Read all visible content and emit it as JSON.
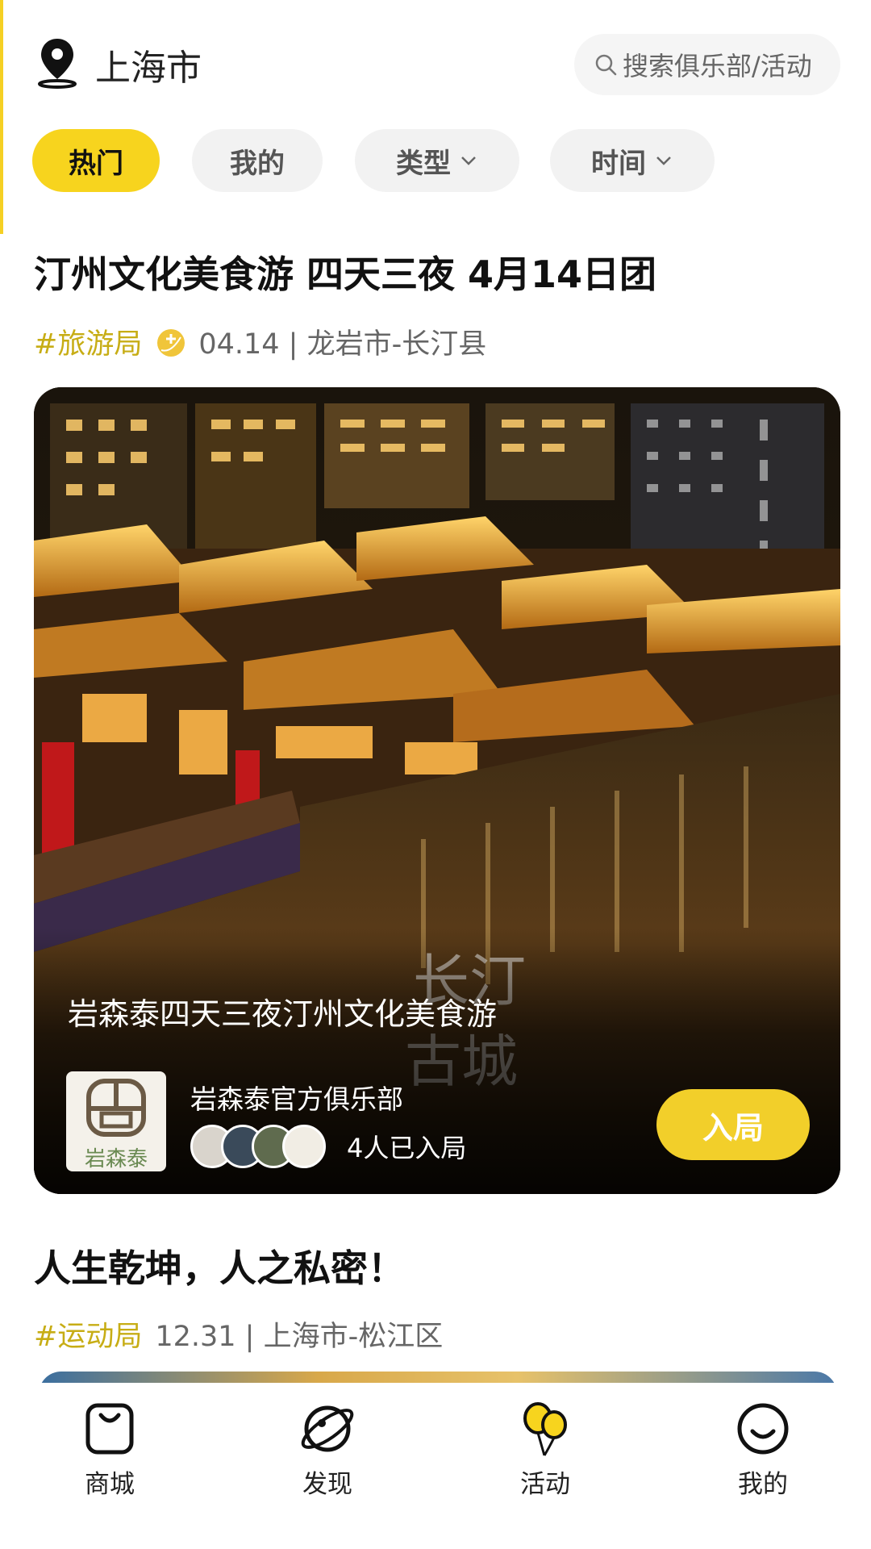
{
  "header": {
    "city": "上海市",
    "search_placeholder": "搜索俱乐部/活动"
  },
  "filters": [
    {
      "label": "热门",
      "active": true
    },
    {
      "label": "我的",
      "active": false
    },
    {
      "label": "类型",
      "active": false
    },
    {
      "label": "时间",
      "active": false
    }
  ],
  "posts": [
    {
      "title": "汀州文化美食游 四天三夜 4月14日团",
      "tag": "#旅游局",
      "date_location": "04.14 | 龙岩市-长汀县",
      "card": {
        "caption": "岩森泰四天三夜汀州文化美食游",
        "club_name": "岩森泰官方俱乐部",
        "club_logo_text": "岩森泰",
        "joined_text": "4人已入局",
        "join_button": "入局",
        "watermark": "长汀古城"
      }
    },
    {
      "title": "人生乾坤，人之私密！",
      "tag": "#运动局",
      "date_location": "12.31 | 上海市-松江区"
    }
  ],
  "nav": [
    {
      "label": "商城",
      "icon": "bag-icon"
    },
    {
      "label": "发现",
      "icon": "planet-icon"
    },
    {
      "label": "活动",
      "icon": "balloons-icon"
    },
    {
      "label": "我的",
      "icon": "smile-icon"
    }
  ],
  "colors": {
    "accent": "#f7d41e",
    "tag": "#c7ad15",
    "join_button": "#f2cf2a"
  }
}
